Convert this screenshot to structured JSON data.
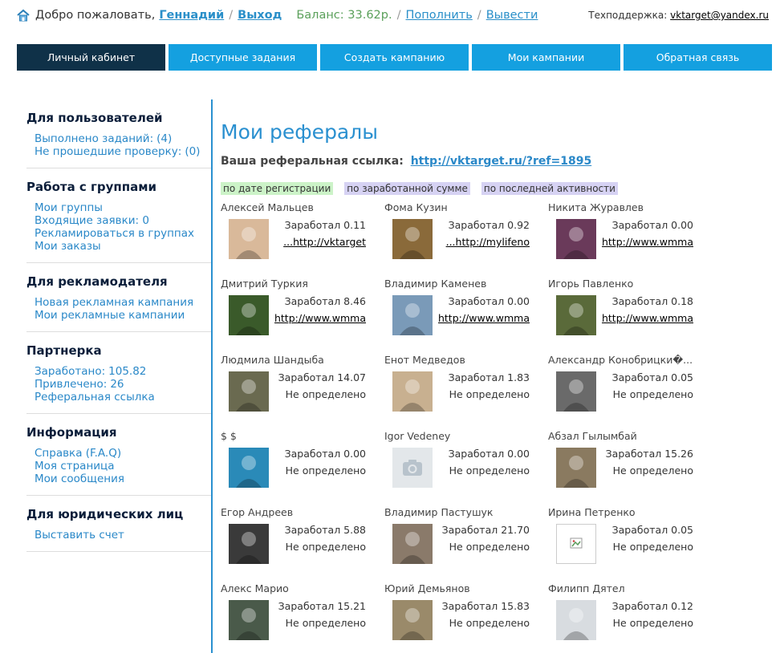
{
  "top": {
    "greeting": "Добро пожаловать,",
    "user": "Геннадий",
    "sep": "/",
    "logout": "Выход",
    "balance": "Баланс: 33.62р.",
    "topup": "Пополнить",
    "withdraw": "Вывести",
    "support_label": "Техподдержка:",
    "support_email": "vktarget@yandex.ru"
  },
  "nav": [
    {
      "label": "Личный кабинет",
      "active": true
    },
    {
      "label": "Доступные задания"
    },
    {
      "label": "Создать кампанию"
    },
    {
      "label": "Мои кампании"
    },
    {
      "label": "Обратная связь"
    }
  ],
  "sidebar": [
    {
      "title": "Для пользователей",
      "items": [
        {
          "label": "Выполнено заданий:",
          "value": "(4)"
        },
        {
          "label": "Не прошедшие проверку:",
          "value": "(0)"
        }
      ]
    },
    {
      "title": "Работа с группами",
      "items": [
        {
          "label": "Мои группы"
        },
        {
          "label": "Входящие заявки: 0"
        },
        {
          "label": "Рекламироваться в группах"
        },
        {
          "label": "Мои заказы"
        }
      ]
    },
    {
      "title": "Для рекламодателя",
      "items": [
        {
          "label": "Новая рекламная кампания"
        },
        {
          "label": "Мои рекламные кампании"
        }
      ]
    },
    {
      "title": "Партнерка",
      "items": [
        {
          "label": "Заработано:",
          "value": "105.82"
        },
        {
          "label": "Привлечено:",
          "value": "26"
        },
        {
          "label": "Реферальная ссылка"
        }
      ]
    },
    {
      "title": "Информация",
      "items": [
        {
          "label": "Справка (F.A.Q)"
        },
        {
          "label": "Моя страница"
        },
        {
          "label": "Мои сообщения"
        }
      ]
    },
    {
      "title": "Для юридических лиц",
      "items": [
        {
          "label": "Выставить счет"
        }
      ]
    }
  ],
  "main": {
    "title": "Мои рефералы",
    "ref_label": "Ваша реферальная ссылка:",
    "ref_link": "http://vktarget.ru/?ref=1895",
    "sorts": [
      "по дате регистрации",
      "по заработанной сумме",
      "по последней активности"
    ],
    "referrals": [
      {
        "name": "Алексей Мальцев",
        "earned": "Заработал 0.11",
        "site": "http://vktarget...",
        "color": "#d9b99a"
      },
      {
        "name": "Фома Кузин",
        "earned": "Заработал 0.92",
        "site": "http://mylifeno...",
        "color": "#8a6a3a"
      },
      {
        "name": "Никита Журавлев",
        "earned": "Заработал 0.00",
        "site": "http://www.wmma...",
        "color": "#6a3a5a"
      },
      {
        "name": "Дмитрий Туркия",
        "earned": "Заработал 8.46",
        "site": "http://www.wmma...",
        "color": "#3a5a2a"
      },
      {
        "name": "Владимир Каменев",
        "earned": "Заработал 0.00",
        "site": "http://www.wmma...",
        "color": "#7a9ab8"
      },
      {
        "name": "Игорь Павленко",
        "earned": "Заработал 0.18",
        "site": "http://www.wmma...",
        "color": "#5a6a3a"
      },
      {
        "name": "Людмила Шандыба",
        "earned": "Заработал 14.07",
        "site": "Не определено",
        "color": "#6a6a50"
      },
      {
        "name": "Енот Медведов",
        "earned": "Заработал 1.83",
        "site": "Не определено",
        "color": "#c8b090"
      },
      {
        "name": "Александр Конобрицки�...",
        "earned": "Заработал 0.05",
        "site": "Не определено",
        "color": "#6a6a6a"
      },
      {
        "name": "$ $",
        "earned": "Заработал 0.00",
        "site": "Не определено",
        "color": "#2a8ab8"
      },
      {
        "name": "Igor Vedeney",
        "earned": "Заработал 0.00",
        "site": "Не определено",
        "color": "#e3e7ea"
      },
      {
        "name": "Абзал Гылымбай",
        "earned": "Заработал 15.26",
        "site": "Не определено",
        "color": "#8a7a60"
      },
      {
        "name": "Егор Андреев",
        "earned": "Заработал 5.88",
        "site": "Не определено",
        "color": "#3a3a3a"
      },
      {
        "name": "Владимир Пастушук",
        "earned": "Заработал 21.70",
        "site": "Не определено",
        "color": "#8a7a6a"
      },
      {
        "name": "Ирина Петренко",
        "earned": "Заработал 0.05",
        "site": "Не определено",
        "color": "#ffffff"
      },
      {
        "name": "Алекс Марио",
        "earned": "Заработал 15.21",
        "site": "Не определено",
        "color": "#4a5a4a"
      },
      {
        "name": "Юрий Демьянов",
        "earned": "Заработал 15.83",
        "site": "Не определено",
        "color": "#9a8a6a"
      },
      {
        "name": "Филипп Дятел",
        "earned": "Заработал 0.12",
        "site": "Не определено",
        "color": "#d8dce0"
      }
    ]
  }
}
